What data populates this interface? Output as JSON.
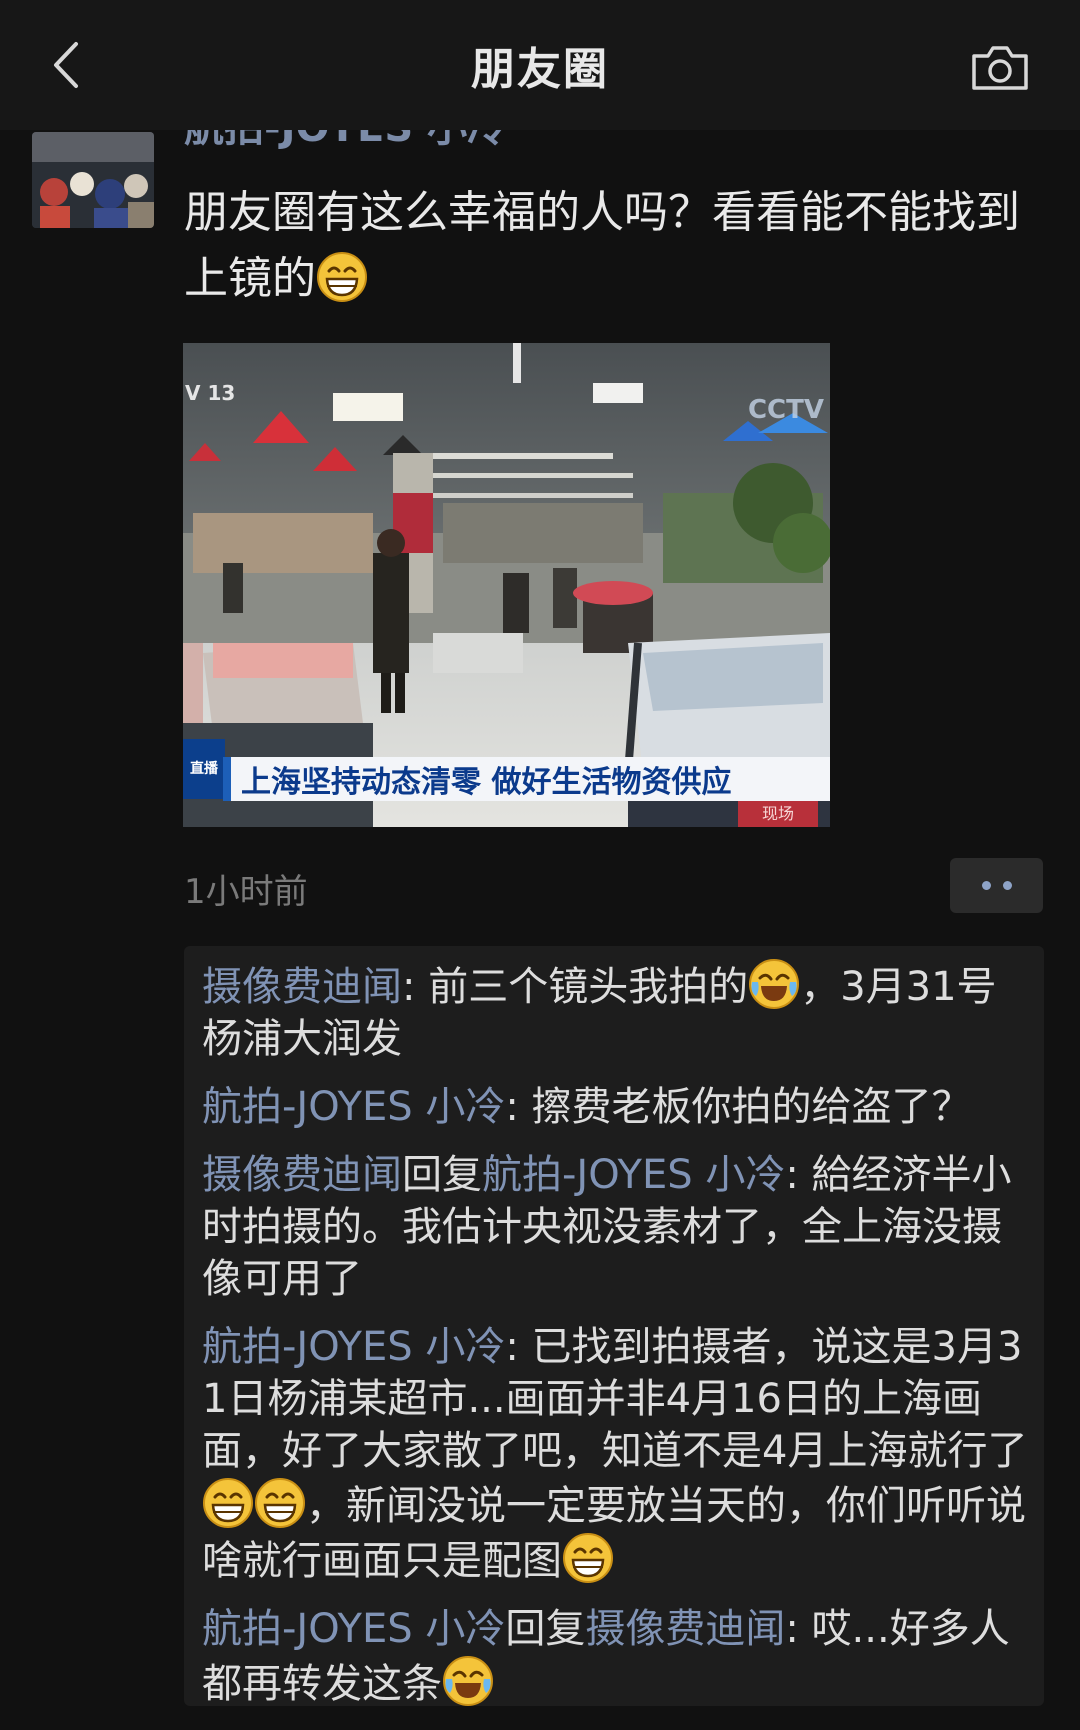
{
  "nav": {
    "title": "朋友圈"
  },
  "post": {
    "author": "航拍-JOYES 小冷",
    "text": "朋友圈有这么幸福的人吗？看看能不能找到上镜的",
    "time": "1小时前",
    "image": {
      "caption": "上海坚持动态清零 做好生活物资供应",
      "channel_mark": "V 13",
      "station_mark": "CCTV",
      "logo_text": "直播",
      "stamp_text": "现场"
    }
  },
  "comments": [
    {
      "author": "摄像费迪闻",
      "reply_to": "",
      "text_parts": [
        "前三个镜头我拍的",
        "，3月31号杨浦大润发"
      ]
    },
    {
      "author": "航拍-JOYES 小冷",
      "reply_to": "",
      "text_parts": [
        "擦费老板你拍的给盗了？"
      ]
    },
    {
      "author": "摄像费迪闻",
      "reply_word": "回复",
      "reply_to": "航拍-JOYES 小冷",
      "text_parts": [
        "給经济半小时拍摄的。我估计央视没素材了，全上海没摄像可用了"
      ]
    },
    {
      "author": "航拍-JOYES 小冷",
      "reply_to": "",
      "text_parts": [
        "已找到拍摄者，说这是3月31日杨浦某超市...画面并非4月16日的上海画面，好了大家散了吧，知道不是4月上海就行了",
        "，新闻没说一定要放当天的，你们听听说啥就行画面只是配图"
      ]
    },
    {
      "author": "航拍-JOYES 小冷",
      "reply_word": "回复",
      "reply_to": "摄像费迪闻",
      "text_parts": [
        "哎...好多人都再转发这条"
      ]
    }
  ],
  "icons": {
    "back": "chevron-left-icon",
    "camera": "camera-icon",
    "more": "more-dots-icon",
    "grin": "grin-emoji-icon",
    "laugh_cry": "laugh-cry-emoji-icon"
  },
  "colors": {
    "background": "#111111",
    "name_link": "#8093b5",
    "text": "#e9e9e9",
    "time": "#7a7a7a"
  }
}
